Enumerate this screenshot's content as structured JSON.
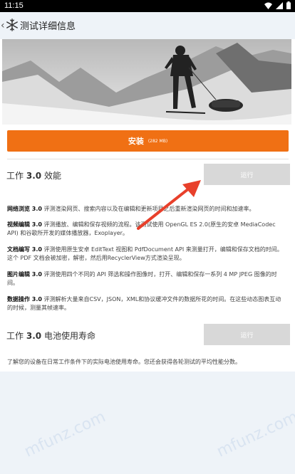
{
  "status": {
    "time": "11:15"
  },
  "app_bar": {
    "title": "测试详细信息"
  },
  "install": {
    "label": "安装",
    "size": "(282 MB)"
  },
  "work": {
    "title_prefix": "工作",
    "title_version": "3.0",
    "title_suffix": "效能",
    "run_label": "运行",
    "items": [
      {
        "name": "网络浏览 3.0",
        "text": "评测渲染网页、搜索内容以及在编辑和更新项目之后重新渲染网页的时间和加速率。"
      },
      {
        "name": "视频编辑 3.0",
        "text": "评测播放、编辑和保存视频的流程。该测试使用 OpenGL ES 2.0(原生的安卓 MediaCodec API) 和谷歌所开发的媒体播放器，Exoplayer。"
      },
      {
        "name": "文档编写 3.0",
        "text": "评测使用原生安卓 EditText 视图和 PdfDocument API 来测量打开，编辑和保存文档的时间。这个 PDF 文档会被加密，解密，然后用RecyclerView方式渲染呈现。"
      },
      {
        "name": "图片编辑 3.0",
        "text": "评测使用四个不同的 API 筛选和操作图像时，打开、编辑和保存一系列 4 MP JPEG 图像的时间。"
      },
      {
        "name": "数据操作 3.0",
        "text": "评测解析大量来自CSV，JSON，XML和协议缓冲文件的数据所花的时间。在这些动态图表互动的时候，测量其帧速率。"
      }
    ]
  },
  "battery": {
    "title_prefix": "工作",
    "title_version": "3.0",
    "title_suffix": "电池使用寿命",
    "run_label": "运行",
    "desc": "了解您的设备在日常工作条件下的实际电池使用寿命。您还会获得各轮测试的平均性能分数。"
  },
  "watermark": "mfunz.com",
  "colors": {
    "accent": "#f07014",
    "disabled_button": "#d8d8d8",
    "background": "#eef3f8",
    "arrow": "#e8402b"
  }
}
